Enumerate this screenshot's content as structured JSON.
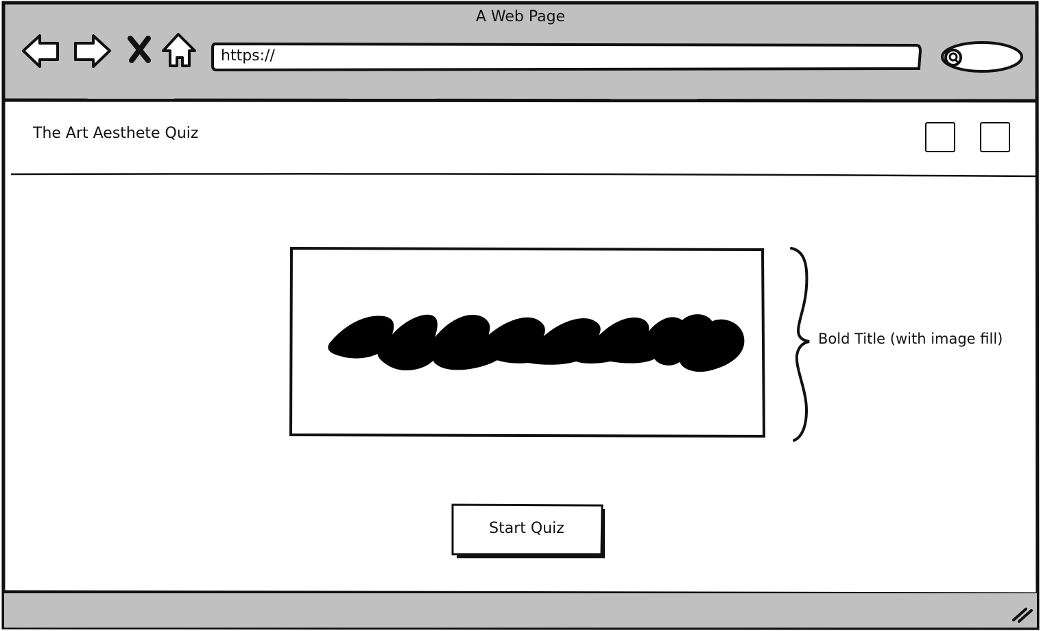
{
  "browser": {
    "window_title": "A Web Page",
    "url": "https://",
    "nav_icons": [
      "back-arrow-icon",
      "forward-arrow-icon",
      "close-x-icon",
      "home-icon"
    ],
    "search_icon": "search-icon",
    "resize_icon": "resize-grip-icon"
  },
  "header": {
    "site_title": "The Art Aesthete Quiz",
    "icon_boxes": [
      "placeholder-box-1",
      "placeholder-box-2"
    ]
  },
  "hero": {
    "title_image": "scribble-title-placeholder",
    "annotation": "Bold Title (with image fill)"
  },
  "actions": {
    "start_label": "Start Quiz"
  },
  "colors": {
    "chrome": "#c0c0c0",
    "ink": "#111111",
    "page": "#ffffff"
  }
}
